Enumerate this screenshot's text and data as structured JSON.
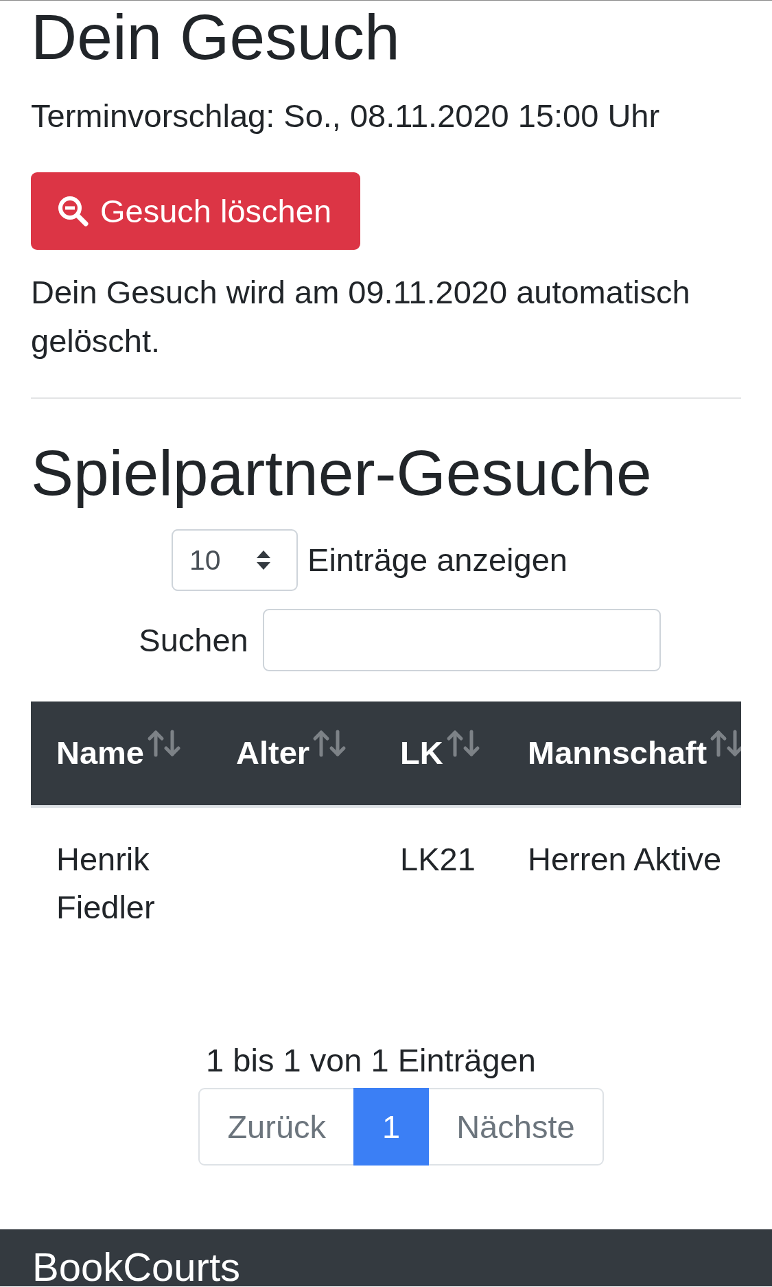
{
  "request": {
    "title": "Dein Gesuch",
    "proposal": "Terminvorschlag: So., 08.11.2020 15:00 Uhr",
    "delete_button": {
      "label": "Gesuch löschen"
    },
    "note": "Dein Gesuch wird am 09.11.2020 automatisch gelöscht."
  },
  "listing": {
    "title": "Spielpartner-Gesuche",
    "page_length": {
      "value": "10",
      "label": "Einträge anzeigen"
    },
    "search": {
      "label": "Suchen"
    },
    "table": {
      "columns": [
        {
          "label": "Name"
        },
        {
          "label": "Alter"
        },
        {
          "label": "LK"
        },
        {
          "label": "Mannschaft"
        }
      ],
      "rows": [
        {
          "cells": [
            "Henrik Fiedler",
            null,
            "LK21",
            "Herren Aktive"
          ]
        }
      ]
    },
    "info": "1 bis 1 von 1 Einträgen",
    "pagination": {
      "previous": {
        "label": "Zurück",
        "disabled": true
      },
      "pages": [
        {
          "label": "1",
          "selected": true
        }
      ],
      "next": {
        "label": "Nächste",
        "disabled": true
      }
    }
  },
  "footer": {
    "brand": "BookCourts"
  }
}
